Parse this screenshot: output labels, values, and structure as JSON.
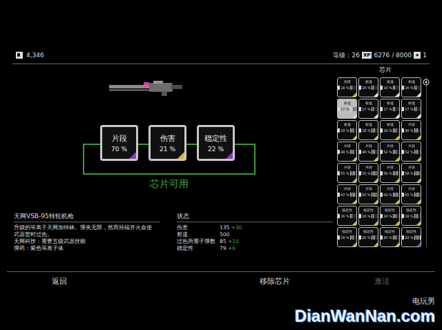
{
  "currency": "4,346",
  "level": {
    "label": "等级：",
    "value": "26",
    "xp_badge": "XP",
    "xp": "6276 / 8000",
    "star_badge": "★",
    "stars_count": "1"
  },
  "slots": [
    {
      "label": "片段",
      "value": "70 %",
      "color": "#8a3cc4"
    },
    {
      "label": "伤害",
      "value": "21 %",
      "color": "#d9b93b"
    },
    {
      "label": "稳定性",
      "value": "22 %",
      "color": "#8a3cc4"
    }
  ],
  "slots_status": "芯片可用",
  "weapon": {
    "name": "天网VSB-95转轮机枪",
    "description": [
      "升级的等离子天网加特林。弹夹无限，然而持续开火会使",
      "武器暂时过热。",
      "天网科技：需要五级武器技能",
      "弹药：紫色等离子体"
    ]
  },
  "stats": {
    "title": "状态",
    "rows": [
      {
        "label": "伤害",
        "value": "135",
        "bonus": "+30"
      },
      {
        "label": "射速",
        "value": "500",
        "bonus": ""
      },
      {
        "label": "过热所需子弹数",
        "value": "85",
        "bonus": "+10"
      },
      {
        "label": "稳定性",
        "value": "79",
        "bonus": "+6"
      }
    ]
  },
  "chips": {
    "title": "芯片",
    "items": [
      {
        "label": "伤害",
        "value": "18 %",
        "level": 0.4,
        "color": "#d9b93b",
        "selected": false
      },
      {
        "label": "射速",
        "value": "16 %",
        "level": 0.4,
        "color": "#dddddd",
        "selected": false
      },
      {
        "label": "射速",
        "value": "16 %",
        "level": 0.4,
        "color": "#dddddd",
        "selected": false
      },
      {
        "label": "射速",
        "value": "16 %",
        "level": 0.4,
        "color": "#dddddd",
        "selected": false
      },
      {
        "label": "射速",
        "value": "17 %",
        "level": 0.4,
        "color": "#dddddd",
        "selected": true
      },
      {
        "label": "射速",
        "value": "17 %",
        "level": 0.4,
        "color": "#dddddd",
        "selected": false
      },
      {
        "label": "射速",
        "value": "17 %",
        "level": 0.4,
        "color": "#dddddd",
        "selected": false
      },
      {
        "label": "射速",
        "value": "17 %",
        "level": 0.4,
        "color": "#dddddd",
        "selected": false
      },
      {
        "label": "射速",
        "value": "18 %",
        "level": 0.6,
        "color": "#d9b93b",
        "selected": false
      },
      {
        "label": "射速",
        "value": "18 %",
        "level": 0.6,
        "color": "#d9b93b",
        "selected": false
      },
      {
        "label": "射速",
        "value": "18 %",
        "level": 0.6,
        "color": "#d9b93b",
        "selected": false
      },
      {
        "label": "片段",
        "value": "48 %",
        "level": 0.6,
        "color": "#d9b93b",
        "selected": false
      },
      {
        "label": "片段",
        "value": "48 %",
        "level": 0.6,
        "color": "#d9b93b",
        "selected": false
      },
      {
        "label": "片段",
        "value": "48 %",
        "level": 0.6,
        "color": "#d9b93b",
        "selected": false
      },
      {
        "label": "片段",
        "value": "52 %",
        "level": 0.6,
        "color": "#d9b93b",
        "selected": false
      },
      {
        "label": "片段",
        "value": "52 %",
        "level": 0.6,
        "color": "#d9b93b",
        "selected": false
      },
      {
        "label": "片段",
        "value": "55 %",
        "level": 0.8,
        "color": "#d9b93b",
        "selected": false
      },
      {
        "label": "片段",
        "value": "55 %",
        "level": 0.8,
        "color": "#d9b93b",
        "selected": false
      },
      {
        "label": "片段",
        "value": "58 %",
        "level": 0.8,
        "color": "#d9b93b",
        "selected": false
      },
      {
        "label": "片段",
        "value": "58 %",
        "level": 0.8,
        "color": "#d9b93b",
        "selected": false
      },
      {
        "label": "片段",
        "value": "60 %",
        "level": 0.8,
        "color": "#d9b93b",
        "selected": false
      },
      {
        "label": "片段",
        "value": "60 %",
        "level": 0.8,
        "color": "#d9b93b",
        "selected": false
      },
      {
        "label": "片段",
        "value": "62 %",
        "level": 0.8,
        "color": "#d9b93b",
        "selected": false
      },
      {
        "label": "片段",
        "value": "65 %",
        "level": 0.8,
        "color": "#d9b93b",
        "selected": false
      },
      {
        "label": "稳定性",
        "value": "16 %",
        "level": 0.4,
        "color": "#d9b93b",
        "selected": false
      },
      {
        "label": "稳定性",
        "value": "16 %",
        "level": 0.4,
        "color": "#d9b93b",
        "selected": false
      },
      {
        "label": "稳定性",
        "value": "18 %",
        "level": 0.6,
        "color": "#d9b93b",
        "selected": false
      },
      {
        "label": "稳定性",
        "value": "18 %",
        "level": 0.6,
        "color": "#d9b93b",
        "selected": false
      },
      {
        "label": "稳定性",
        "value": "18 %",
        "level": 0.6,
        "color": "#d9b93b",
        "selected": false
      },
      {
        "label": "稳定性",
        "value": "20 %",
        "level": 0.6,
        "color": "#d9b93b",
        "selected": false
      },
      {
        "label": "稳定性",
        "value": "20 %",
        "level": 0.6,
        "color": "#d9b93b",
        "selected": false
      },
      {
        "label": "稳定性",
        "value": "22 %",
        "level": 1,
        "color": "#8a3cc4",
        "selected": false
      }
    ]
  },
  "buttons": [
    {
      "label": "返回",
      "disabled": false
    },
    {
      "label": "移除芯片",
      "disabled": false
    },
    {
      "label": "激活",
      "disabled": true
    }
  ],
  "watermark": {
    "logo": "电玩男",
    "site": "DianWanNan.com"
  }
}
